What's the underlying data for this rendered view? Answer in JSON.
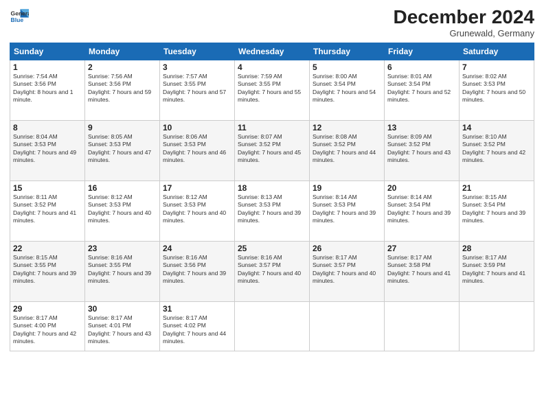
{
  "header": {
    "logo_line1": "General",
    "logo_line2": "Blue",
    "month": "December 2024",
    "location": "Grunewald, Germany"
  },
  "days_of_week": [
    "Sunday",
    "Monday",
    "Tuesday",
    "Wednesday",
    "Thursday",
    "Friday",
    "Saturday"
  ],
  "weeks": [
    [
      {
        "day": "1",
        "sunrise": "7:54 AM",
        "sunset": "3:56 PM",
        "daylight": "8 hours and 1 minute."
      },
      {
        "day": "2",
        "sunrise": "7:56 AM",
        "sunset": "3:56 PM",
        "daylight": "7 hours and 59 minutes."
      },
      {
        "day": "3",
        "sunrise": "7:57 AM",
        "sunset": "3:55 PM",
        "daylight": "7 hours and 57 minutes."
      },
      {
        "day": "4",
        "sunrise": "7:59 AM",
        "sunset": "3:55 PM",
        "daylight": "7 hours and 55 minutes."
      },
      {
        "day": "5",
        "sunrise": "8:00 AM",
        "sunset": "3:54 PM",
        "daylight": "7 hours and 54 minutes."
      },
      {
        "day": "6",
        "sunrise": "8:01 AM",
        "sunset": "3:54 PM",
        "daylight": "7 hours and 52 minutes."
      },
      {
        "day": "7",
        "sunrise": "8:02 AM",
        "sunset": "3:53 PM",
        "daylight": "7 hours and 50 minutes."
      }
    ],
    [
      {
        "day": "8",
        "sunrise": "8:04 AM",
        "sunset": "3:53 PM",
        "daylight": "7 hours and 49 minutes."
      },
      {
        "day": "9",
        "sunrise": "8:05 AM",
        "sunset": "3:53 PM",
        "daylight": "7 hours and 47 minutes."
      },
      {
        "day": "10",
        "sunrise": "8:06 AM",
        "sunset": "3:53 PM",
        "daylight": "7 hours and 46 minutes."
      },
      {
        "day": "11",
        "sunrise": "8:07 AM",
        "sunset": "3:52 PM",
        "daylight": "7 hours and 45 minutes."
      },
      {
        "day": "12",
        "sunrise": "8:08 AM",
        "sunset": "3:52 PM",
        "daylight": "7 hours and 44 minutes."
      },
      {
        "day": "13",
        "sunrise": "8:09 AM",
        "sunset": "3:52 PM",
        "daylight": "7 hours and 43 minutes."
      },
      {
        "day": "14",
        "sunrise": "8:10 AM",
        "sunset": "3:52 PM",
        "daylight": "7 hours and 42 minutes."
      }
    ],
    [
      {
        "day": "15",
        "sunrise": "8:11 AM",
        "sunset": "3:52 PM",
        "daylight": "7 hours and 41 minutes."
      },
      {
        "day": "16",
        "sunrise": "8:12 AM",
        "sunset": "3:53 PM",
        "daylight": "7 hours and 40 minutes."
      },
      {
        "day": "17",
        "sunrise": "8:12 AM",
        "sunset": "3:53 PM",
        "daylight": "7 hours and 40 minutes."
      },
      {
        "day": "18",
        "sunrise": "8:13 AM",
        "sunset": "3:53 PM",
        "daylight": "7 hours and 39 minutes."
      },
      {
        "day": "19",
        "sunrise": "8:14 AM",
        "sunset": "3:53 PM",
        "daylight": "7 hours and 39 minutes."
      },
      {
        "day": "20",
        "sunrise": "8:14 AM",
        "sunset": "3:54 PM",
        "daylight": "7 hours and 39 minutes."
      },
      {
        "day": "21",
        "sunrise": "8:15 AM",
        "sunset": "3:54 PM",
        "daylight": "7 hours and 39 minutes."
      }
    ],
    [
      {
        "day": "22",
        "sunrise": "8:15 AM",
        "sunset": "3:55 PM",
        "daylight": "7 hours and 39 minutes."
      },
      {
        "day": "23",
        "sunrise": "8:16 AM",
        "sunset": "3:55 PM",
        "daylight": "7 hours and 39 minutes."
      },
      {
        "day": "24",
        "sunrise": "8:16 AM",
        "sunset": "3:56 PM",
        "daylight": "7 hours and 39 minutes."
      },
      {
        "day": "25",
        "sunrise": "8:16 AM",
        "sunset": "3:57 PM",
        "daylight": "7 hours and 40 minutes."
      },
      {
        "day": "26",
        "sunrise": "8:17 AM",
        "sunset": "3:57 PM",
        "daylight": "7 hours and 40 minutes."
      },
      {
        "day": "27",
        "sunrise": "8:17 AM",
        "sunset": "3:58 PM",
        "daylight": "7 hours and 41 minutes."
      },
      {
        "day": "28",
        "sunrise": "8:17 AM",
        "sunset": "3:59 PM",
        "daylight": "7 hours and 41 minutes."
      }
    ],
    [
      {
        "day": "29",
        "sunrise": "8:17 AM",
        "sunset": "4:00 PM",
        "daylight": "7 hours and 42 minutes."
      },
      {
        "day": "30",
        "sunrise": "8:17 AM",
        "sunset": "4:01 PM",
        "daylight": "7 hours and 43 minutes."
      },
      {
        "day": "31",
        "sunrise": "8:17 AM",
        "sunset": "4:02 PM",
        "daylight": "7 hours and 44 minutes."
      },
      null,
      null,
      null,
      null
    ]
  ]
}
